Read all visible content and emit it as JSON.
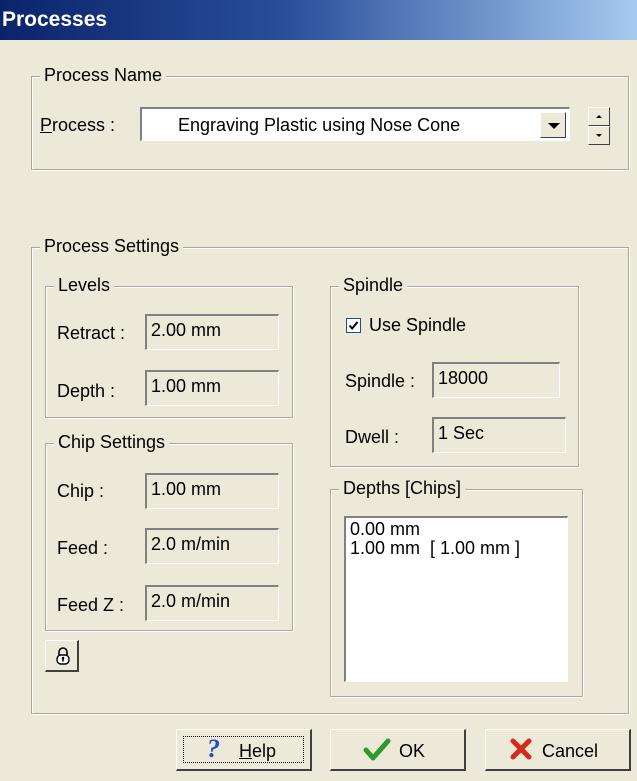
{
  "window": {
    "title": "Processes"
  },
  "process_name": {
    "legend": "Process Name",
    "process_label_underline": "P",
    "process_label_rest": "rocess :",
    "selected_process": "Engraving Plastic using Nose Cone"
  },
  "process_settings": {
    "legend": "Process Settings",
    "levels": {
      "legend": "Levels",
      "retract_label": "Retract :",
      "retract_value": "2.00 mm",
      "depth_label": "Depth :",
      "depth_value": "1.00 mm"
    },
    "chip_settings": {
      "legend": "Chip Settings",
      "chip_label": "Chip :",
      "chip_value": "1.00 mm",
      "feed_label": "Feed :",
      "feed_value": "2.0 m/min",
      "feedz_label": "Feed Z :",
      "feedz_value": "2.0 m/min"
    },
    "spindle": {
      "legend": "Spindle",
      "use_spindle_label": "Use Spindle",
      "use_spindle_checked": true,
      "spindle_label": "Spindle :",
      "spindle_value": "18000",
      "dwell_label": "Dwell :",
      "dwell_value": "1 Sec"
    },
    "depths": {
      "legend": "Depths [Chips]",
      "items": [
        "0.00 mm",
        "1.00 mm  [ 1.00 mm ]"
      ]
    }
  },
  "footer": {
    "help_underline": "H",
    "help_rest": "elp",
    "ok_label": "OK",
    "cancel_label": "Cancel"
  },
  "icons": {
    "lock": "lock-icon",
    "help": "question-mark-icon",
    "ok": "checkmark-icon",
    "cancel": "x-icon"
  },
  "colors": {
    "title_bar_start": "#0A246A",
    "title_bar_end": "#A6CAF0",
    "dialog_bg": "#ECE9D8",
    "ok_green": "#2E9A2E",
    "cancel_red": "#D42A1A",
    "help_blue": "#1E4FC8"
  }
}
